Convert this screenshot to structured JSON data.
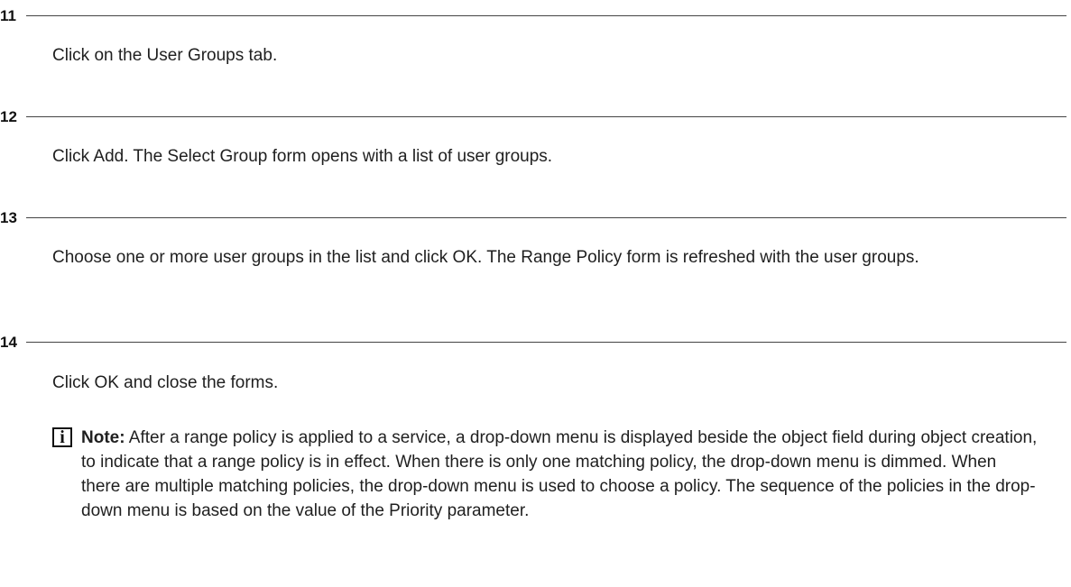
{
  "steps": [
    {
      "number": "11",
      "text": "Click on the User Groups tab."
    },
    {
      "number": "12",
      "text": "Click Add. The Select Group form opens with a list of user groups."
    },
    {
      "number": "13",
      "text": "Choose one or more user groups in the list and click OK. The Range Policy form is refreshed with the user groups."
    },
    {
      "number": "14",
      "text": "Click OK and close the forms."
    }
  ],
  "note": {
    "icon": "info-icon",
    "icon_glyph": "i",
    "label": "Note:",
    "text": "After a range policy is applied to a service, a drop-down menu is displayed beside the object field during object creation, to indicate that a range policy is in effect. When there is only one matching policy, the drop-down menu is dimmed. When there are multiple matching policies, the drop-down menu is used to choose a policy. The sequence of the policies in the drop-down menu is based on the value of the Priority parameter."
  }
}
